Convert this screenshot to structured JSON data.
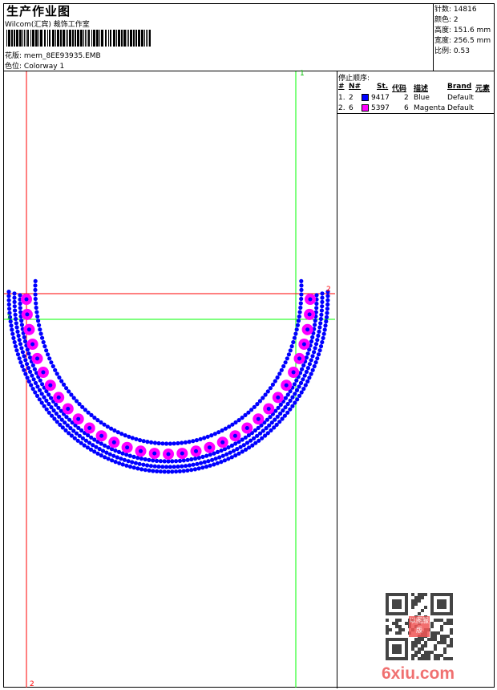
{
  "header": {
    "title": "生产作业图",
    "company": "Wilcom(汇宾) 裁饰工作室",
    "design_label": "花版:",
    "design_file": "mem_8EE93935.EMB",
    "colorway_label": "色位:",
    "colorway": "Colorway 1"
  },
  "info": [
    {
      "label": "针数:",
      "value": "14816"
    },
    {
      "label": "颜色:",
      "value": "2"
    },
    {
      "label": "高度:",
      "value": "151.6 mm"
    },
    {
      "label": "宽度:",
      "value": "256.5 mm"
    },
    {
      "label": "比例:",
      "value": "0.53"
    }
  ],
  "stop_sequence": {
    "title": "停止顺序:",
    "headers": [
      "#",
      "N#",
      "St.",
      "代码",
      "描述",
      "Brand",
      "元素"
    ],
    "rows": [
      {
        "idx": "1.",
        "n": "2",
        "color": "#0000ff",
        "st": "9417",
        "code": "2",
        "desc": "Blue",
        "brand": "Default"
      },
      {
        "idx": "2.",
        "n": "6",
        "color": "#ff00ff",
        "st": "5397",
        "code": "6",
        "desc": "Magenta",
        "brand": "Default"
      }
    ]
  },
  "markers": {
    "v1": "1",
    "v2": "2",
    "h1": "1",
    "h2": "2"
  },
  "colors": {
    "blue": "#0000ff",
    "magenta": "#ff00ff",
    "red_guide": "#ff0000",
    "green_guide": "#00ff00"
  },
  "watermark": {
    "text": "6xiu.com",
    "stamp": "以图服版"
  }
}
